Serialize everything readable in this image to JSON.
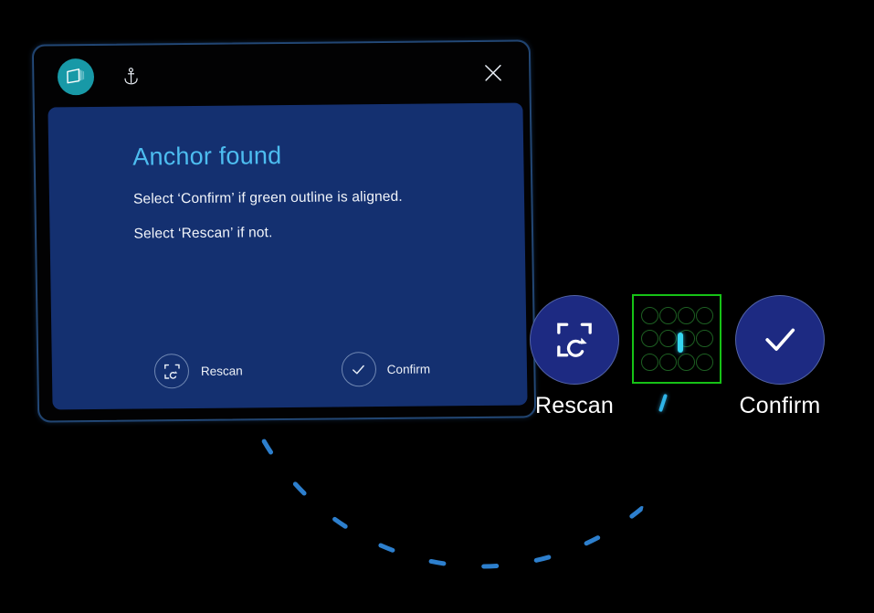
{
  "window": {
    "app_icon": "slate-app-icon",
    "anchor_icon": "anchor-icon",
    "close_icon": "close-icon"
  },
  "dialog": {
    "title": "Anchor found",
    "lines": [
      "Select ‘Confirm’ if green outline is aligned.",
      "Select ‘Rescan’ if not."
    ],
    "actions": [
      {
        "id": "rescan",
        "label": "Rescan",
        "icon": "scan-refresh-icon"
      },
      {
        "id": "confirm",
        "label": "Confirm",
        "icon": "check-icon"
      }
    ]
  },
  "floating_buttons": [
    {
      "id": "rescan",
      "label": "Rescan",
      "icon": "scan-refresh-icon"
    },
    {
      "id": "confirm",
      "label": "Confirm",
      "icon": "check-icon"
    }
  ],
  "anchor_marker": {
    "name": "green-anchor-outline",
    "grid_columns": 4,
    "grid_rows": 3,
    "cursor": "cyan-cursor-bar"
  },
  "colors": {
    "panel_blue": "#143070",
    "heading_blue": "#4dbdf0",
    "button_navy": "#1d2a82",
    "accent_teal": "#1899a7",
    "outline_green": "#16c216",
    "cursor_cyan": "#35d6f0",
    "arc_blue": "#2f86d8",
    "background": "#000000"
  }
}
